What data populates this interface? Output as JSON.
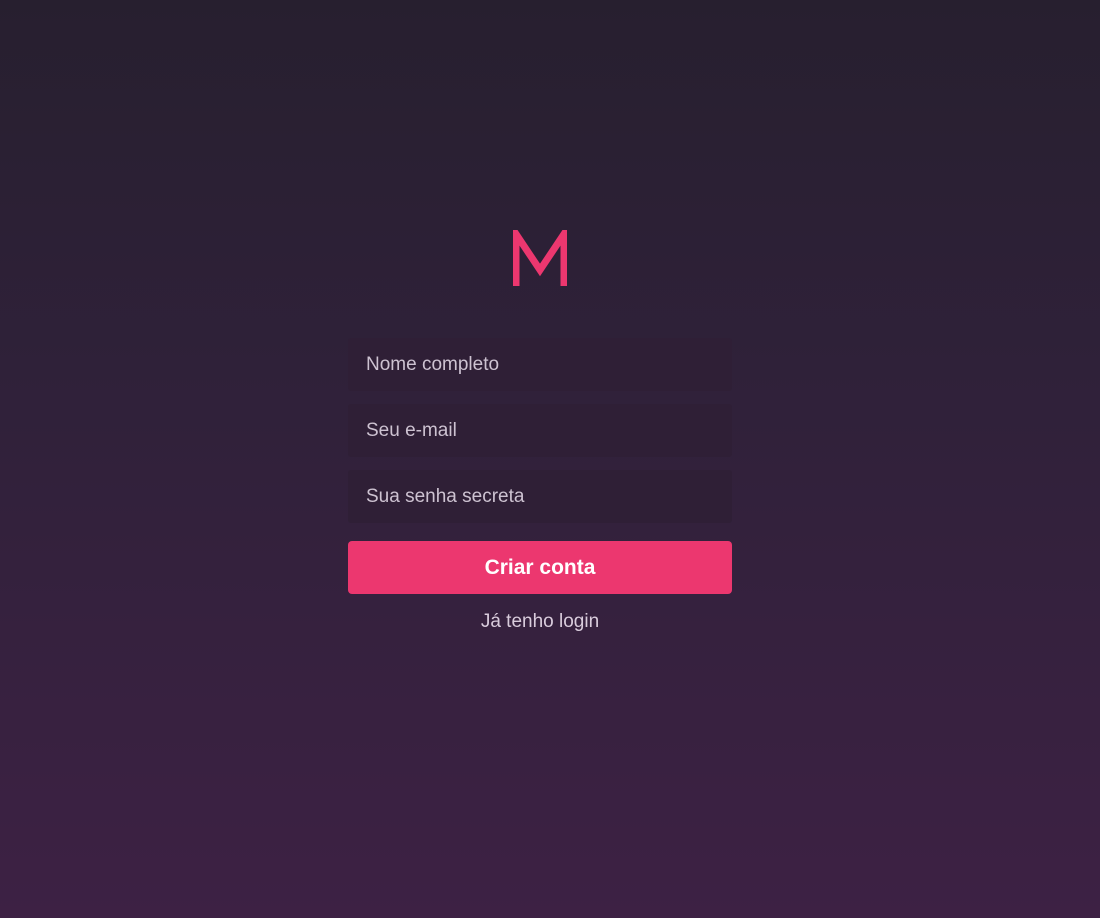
{
  "colors": {
    "accent": "#ec376f",
    "field_bg": "#2f1f36",
    "text_muted": "#cdc2d1"
  },
  "logo": {
    "icon": "m-logo-icon"
  },
  "form": {
    "name_placeholder": "Nome completo",
    "email_placeholder": "Seu e-mail",
    "password_placeholder": "Sua senha secreta",
    "submit_label": "Criar conta",
    "login_link": "Já tenho login"
  }
}
